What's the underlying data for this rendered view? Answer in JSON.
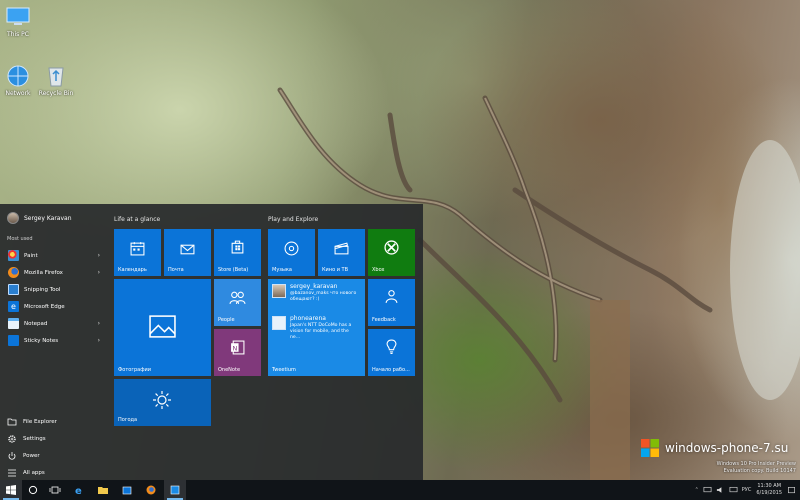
{
  "desktop": {
    "icons": [
      {
        "label": "This PC",
        "icon": "computer-icon"
      },
      {
        "label": "Network",
        "icon": "network-icon"
      },
      {
        "label": "Recycle Bin",
        "icon": "recycle-bin-icon"
      }
    ]
  },
  "start_menu": {
    "user_name": "Sergey Karavan",
    "most_used_label": "Most used",
    "apps": [
      {
        "label": "Paint",
        "icon": "paint-icon",
        "has_submenu": true
      },
      {
        "label": "Mozilla Firefox",
        "icon": "firefox-icon",
        "has_submenu": true
      },
      {
        "label": "Snipping Tool",
        "icon": "snipping-tool-icon",
        "has_submenu": false
      },
      {
        "label": "Microsoft Edge",
        "icon": "edge-icon",
        "has_submenu": false
      },
      {
        "label": "Notepad",
        "icon": "notepad-icon",
        "has_submenu": true
      },
      {
        "label": "Sticky Notes",
        "icon": "sticky-notes-icon",
        "has_submenu": true
      }
    ],
    "bottom": [
      {
        "label": "File Explorer",
        "icon": "file-explorer-icon"
      },
      {
        "label": "Settings",
        "icon": "gear-icon"
      },
      {
        "label": "Power",
        "icon": "power-icon"
      },
      {
        "label": "All apps",
        "icon": "all-apps-icon"
      }
    ],
    "groups": [
      {
        "title": "Life at a glance"
      },
      {
        "title": "Play and Explore"
      }
    ],
    "tiles": {
      "calendar": "Календарь",
      "mail": "Почта",
      "store": "Store (Beta)",
      "photos": "Фотографии",
      "people": "People",
      "onenote": "OneNote",
      "weather": "Погода",
      "music": "Музыка",
      "video": "Кино и ТВ",
      "xbox": "Xbox",
      "feedback": "Feedback",
      "tips": "Начало рабо...",
      "tweetium": "Tweetium",
      "tweet1_user": "sergey_karavan",
      "tweet1_text": "@bazanov_maks что нового обещают? :)",
      "tweet2_user": "phonearena",
      "tweet2_text": "Japan's NTT DoCoMo has a vision for mobile, and the ne..."
    }
  },
  "taskbar": {
    "items": [
      "start-icon",
      "cortana-icon",
      "task-view-icon",
      "edge-icon",
      "file-explorer-icon",
      "store-icon",
      "firefox-icon",
      "tweetium-icon"
    ],
    "language": "РУС",
    "time": "11:30 AM",
    "date": "6/19/2015"
  },
  "watermark": {
    "text": "windows-phone-7.su",
    "line1": "Windows 10 Pro Insider Preview",
    "line2": "Evaluation copy. Build 10147"
  },
  "colors": {
    "tile_blue": "#0b74d8",
    "tile_dark_blue": "#0a63b8",
    "xbox_green": "#107c10",
    "onenote_purple": "#80397b",
    "people_blue": "#2f8ae0"
  }
}
